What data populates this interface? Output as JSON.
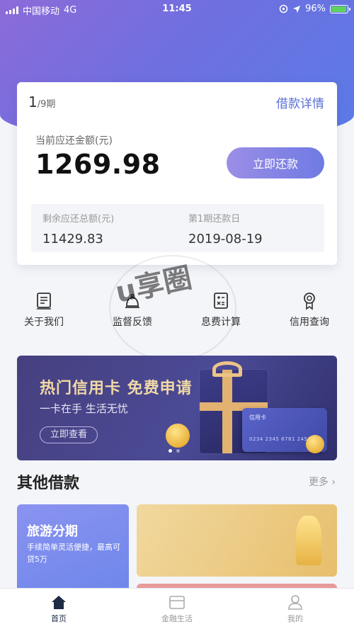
{
  "status_bar": {
    "carrier": "中国移动",
    "network": "4G",
    "time": "11:45",
    "battery": "96%"
  },
  "loan_card": {
    "period_current": "1",
    "period_total": "/9期",
    "detail_link": "借款详情",
    "due_label": "当前应还金额(元)",
    "due_amount": "1269.98",
    "repay_button": "立即还款",
    "remaining_label": "剩余应还总额(元)",
    "remaining_value": "11429.83",
    "due_date_label": "第1期还款日",
    "due_date_value": "2019-08-19"
  },
  "quick_actions": [
    {
      "label": "关于我们",
      "icon": "document-icon"
    },
    {
      "label": "监督反馈",
      "icon": "bell-icon"
    },
    {
      "label": "息费计算",
      "icon": "calculator-icon"
    },
    {
      "label": "信用查询",
      "icon": "badge-icon"
    }
  ],
  "watermark": "u享圈",
  "banner": {
    "title": "热门信用卡 免费申请",
    "subtitle": "一卡在手 生活无忧",
    "cta": "立即查看",
    "card_name": "信用卡",
    "card_number": "0234 2345 6781 2450",
    "active_slide": 1,
    "total_slides": 2
  },
  "other_loans": {
    "title": "其他借款",
    "more": "更多",
    "items": [
      {
        "name": "旅游分期",
        "desc": "手续简单灵活便捷，最高可贷5万"
      }
    ]
  },
  "tab_bar": [
    {
      "label": "首页",
      "icon": "home-icon",
      "active": true
    },
    {
      "label": "金融生活",
      "icon": "wallet-icon",
      "active": false
    },
    {
      "label": "我的",
      "icon": "user-icon",
      "active": false
    }
  ],
  "colors": {
    "accent": "#6f7ae3",
    "hero_gradient_start": "#8c6bd8",
    "hero_gradient_end": "#5a7be6",
    "banner_title": "#f1d9a6"
  }
}
